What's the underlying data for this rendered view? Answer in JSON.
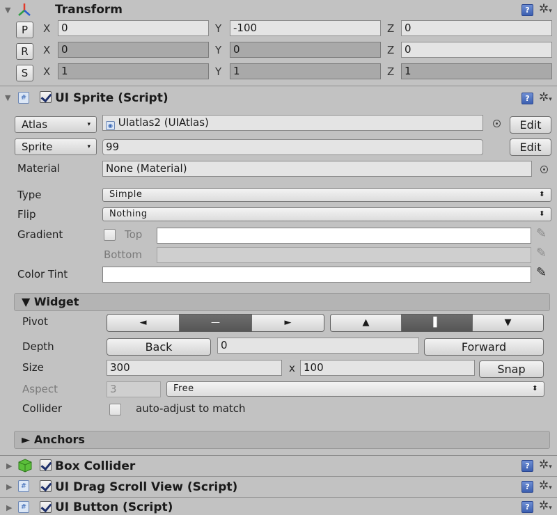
{
  "transform": {
    "title": "Transform",
    "position": {
      "btn": "P",
      "x": "0",
      "y": "-100",
      "z": "0"
    },
    "rotation": {
      "btn": "R",
      "x": "0",
      "y": "0",
      "z": "0"
    },
    "scale": {
      "btn": "S",
      "x": "1",
      "y": "1",
      "z": "1"
    },
    "axis_x": "X",
    "axis_y": "Y",
    "axis_z": "Z"
  },
  "ui_sprite": {
    "title": "UI Sprite (Script)",
    "atlas_label": "Atlas",
    "atlas_value": "UIatlas2 (UIAtlas)",
    "sprite_label": "Sprite",
    "sprite_value": "99",
    "edit_label": "Edit",
    "material_label": "Material",
    "material_value": "None (Material)",
    "type_label": "Type",
    "type_value": "Simple",
    "flip_label": "Flip",
    "flip_value": "Nothing",
    "gradient_label": "Gradient",
    "top_label": "Top",
    "bottom_label": "Bottom",
    "color_tint_label": "Color Tint"
  },
  "widget": {
    "title": "▼ Widget",
    "pivot_label": "Pivot",
    "pivot_h": [
      "◄",
      "—",
      "►"
    ],
    "pivot_v": [
      "▲",
      "▌",
      "▼"
    ],
    "depth_label": "Depth",
    "back_label": "Back",
    "depth_value": "0",
    "forward_label": "Forward",
    "size_label": "Size",
    "size_w": "300",
    "size_x": "x",
    "size_h": "100",
    "snap_label": "Snap",
    "aspect_label": "Aspect",
    "aspect_value": "3",
    "aspect_mode": "Free",
    "collider_label": "Collider",
    "collider_text": "auto-adjust to match"
  },
  "anchors": {
    "title": "► Anchors"
  },
  "components": [
    {
      "title": "Box Collider"
    },
    {
      "title": "UI Drag Scroll View (Script)"
    },
    {
      "title": "UI Button (Script)"
    }
  ],
  "icons": {
    "help": "?",
    "gear": "✲",
    "gear_drop": "▾",
    "select_arrow": "▾",
    "updown": "⬍",
    "eyedropper": "✎"
  }
}
